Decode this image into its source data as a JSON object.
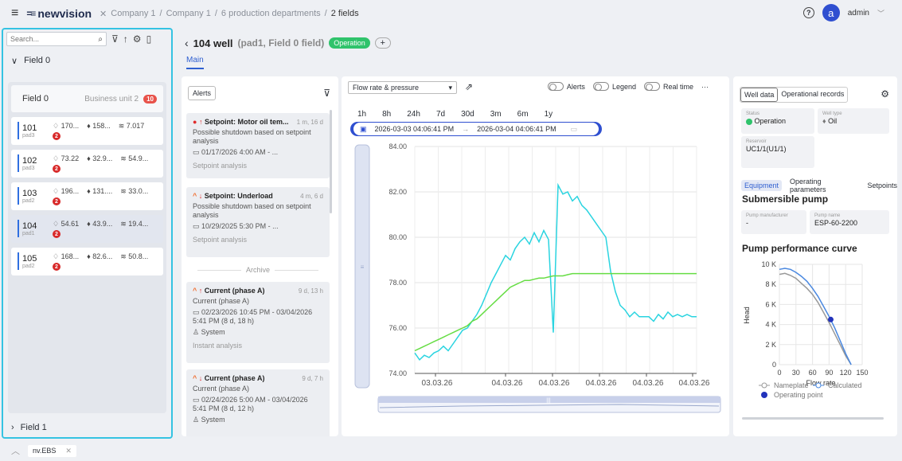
{
  "topbar": {
    "brand": "newvision",
    "breadcrumbs": [
      "Company 1",
      "Company 1",
      "6 production departments"
    ],
    "current": "2 fields",
    "user": "admin",
    "avatar_letter": "a"
  },
  "left": {
    "search_placeholder": "Search...",
    "field0": "Field 0",
    "field_card": {
      "name": "Field 0",
      "unit": "Business unit 2",
      "count": "10"
    },
    "wells": [
      {
        "id": "101",
        "pad": "pad3",
        "v1": "170...",
        "v2": "158...",
        "v3": "7.017",
        "alarms": "2"
      },
      {
        "id": "102",
        "pad": "pad3",
        "v1": "73.22",
        "v2": "32.9...",
        "v3": "54.9...",
        "alarms": "2"
      },
      {
        "id": "103",
        "pad": "pad2",
        "v1": "196...",
        "v2": "131....",
        "v3": "33.0...",
        "alarms": "2"
      },
      {
        "id": "104",
        "pad": "pad1",
        "v1": "54.61",
        "v2": "43.9...",
        "v3": "19.4...",
        "alarms": "2"
      },
      {
        "id": "105",
        "pad": "pad2",
        "v1": "168...",
        "v2": "82.6...",
        "v3": "50.8...",
        "alarms": "2"
      }
    ],
    "field1": "Field 1"
  },
  "bottom": {
    "tab": "nv.EBS"
  },
  "well_header": {
    "title": "104 well",
    "sub": "(pad1, Field 0 field)",
    "status": "Operation",
    "tab": "Main"
  },
  "alerts": {
    "button": "Alerts",
    "archive": "Archive",
    "items": [
      {
        "title": "Setpoint: Motor oil tem...",
        "time": "1 m, 16 d",
        "desc": "Possible shutdown based on setpoint analysis",
        "date": "01/17/2026 4:00 AM - ...",
        "group": "Setpoint analysis"
      },
      {
        "title": "Setpoint: Underload",
        "time": "4 m, 6 d",
        "desc": "Possible shutdown based on setpoint analysis",
        "date": "10/29/2025 5:30 PM - ...",
        "group": "Setpoint analysis"
      },
      {
        "title": "Current (phase A)",
        "time": "9 d, 13 h",
        "desc": "Current (phase A)",
        "date": "02/23/2026 10:45 PM - 03/04/2026 5:41 PM (8 d, 18 h)",
        "user": "System",
        "group": "Instant analysis"
      },
      {
        "title": "Current (phase A)",
        "time": "9 d, 7 h",
        "desc": "Current (phase A)",
        "date": "02/24/2026 5:00 AM - 03/04/2026 5:41 PM (8 d, 12 h)",
        "user": "System"
      }
    ]
  },
  "chart_panel": {
    "select": "Flow rate & pressure",
    "toggles": [
      "Alerts",
      "Legend",
      "Real time"
    ],
    "ranges": [
      "1h",
      "8h",
      "24h",
      "7d",
      "30d",
      "3m",
      "6m",
      "1y"
    ],
    "from": "2026-03-03 04:06:41 PM",
    "to": "2026-03-04 04:06:41 PM"
  },
  "chart_data": {
    "type": "line",
    "ylim": [
      74,
      84
    ],
    "yticks": [
      "84.00",
      "82.00",
      "80.00",
      "78.00",
      "76.00",
      "74.00"
    ],
    "xticks": [
      "03.03.26",
      "04.03.26",
      "04.03.26",
      "04.03.26",
      "04.03.26",
      "04.03.26"
    ],
    "x": [
      0,
      1,
      2,
      3,
      4,
      5,
      6,
      7,
      8,
      9,
      10,
      11,
      12,
      13,
      14,
      15,
      16,
      17,
      18,
      19,
      20,
      21,
      22,
      23,
      24,
      25,
      26,
      27,
      28,
      29,
      30,
      31,
      32,
      33,
      34,
      35,
      36,
      37,
      38,
      39,
      40,
      41,
      42,
      43,
      44,
      45,
      46,
      47,
      48,
      49,
      50,
      51,
      52,
      53,
      54,
      55,
      56,
      57,
      58,
      59
    ],
    "series": [
      {
        "color": "#2ad4e0",
        "values": [
          74.9,
          74.6,
          74.8,
          74.7,
          74.9,
          75.0,
          75.2,
          75.0,
          75.3,
          75.6,
          75.9,
          76.0,
          76.3,
          76.6,
          77.0,
          77.5,
          78.0,
          78.4,
          78.8,
          79.2,
          79.0,
          79.5,
          79.8,
          80.0,
          79.7,
          80.2,
          79.8,
          80.3,
          79.9,
          75.8,
          82.3,
          81.9,
          82.0,
          81.6,
          81.8,
          81.4,
          81.2,
          80.9,
          80.6,
          80.3,
          80.0,
          78.5,
          77.6,
          77.0,
          76.8,
          76.5,
          76.7,
          76.5,
          76.5,
          76.5,
          76.3,
          76.6,
          76.4,
          76.7,
          76.5,
          76.6,
          76.5,
          76.6,
          76.5,
          76.5
        ]
      },
      {
        "color": "#66dd44",
        "values": [
          75.0,
          75.1,
          75.2,
          75.3,
          75.4,
          75.5,
          75.6,
          75.7,
          75.8,
          75.9,
          76.0,
          76.1,
          76.3,
          76.4,
          76.6,
          76.8,
          77.0,
          77.2,
          77.4,
          77.6,
          77.8,
          77.9,
          78.0,
          78.1,
          78.1,
          78.15,
          78.2,
          78.2,
          78.25,
          78.3,
          78.3,
          78.3,
          78.35,
          78.4,
          78.4,
          78.4,
          78.4,
          78.4,
          78.4,
          78.4,
          78.4,
          78.4,
          78.4,
          78.4,
          78.4,
          78.4,
          78.4,
          78.4,
          78.4,
          78.4,
          78.4,
          78.4,
          78.4,
          78.4,
          78.4,
          78.4,
          78.4,
          78.4,
          78.4,
          78.4
        ]
      }
    ]
  },
  "right": {
    "tabs": [
      "Well data",
      "Operational records"
    ],
    "status_label": "Status",
    "status": "Operation",
    "welltype_label": "Well type",
    "welltype": "Oil",
    "reservoir_label": "Reservoir",
    "reservoir": "UC1/1(U1/1)",
    "eq_tabs": [
      "Equipment",
      "Operating parameters",
      "Setpoints"
    ],
    "pump_title": "Submersible pump",
    "manuf_label": "Pump manufacturer",
    "manuf": "-",
    "pumpname_label": "Pump name",
    "pumpname": "ESP-60-2200",
    "curve_title": "Pump performance curve",
    "curve": {
      "yticks": [
        "10 K",
        "8 K",
        "6 K",
        "4 K",
        "2 K",
        "0"
      ],
      "xticks": [
        "0",
        "30",
        "60",
        "90",
        "120",
        "150"
      ],
      "ylabel": "Head",
      "xlabel": "Flow rate",
      "legend": [
        "Nameplate",
        "Calculated",
        "Operating point"
      ],
      "nameplate_color": "#999999",
      "calc_color": "#4a88e0",
      "op_color": "#2233bb",
      "x": [
        0,
        10,
        20,
        30,
        40,
        50,
        60,
        70,
        80,
        90,
        100,
        110,
        120,
        130
      ],
      "nameplate": [
        9.0,
        9.1,
        8.9,
        8.6,
        8.1,
        7.6,
        7.0,
        6.2,
        5.2,
        4.2,
        3.1,
        2.0,
        0.9,
        0
      ],
      "calculated": [
        9.5,
        9.6,
        9.5,
        9.2,
        8.8,
        8.3,
        7.6,
        6.8,
        5.8,
        4.8,
        3.7,
        2.4,
        1.1,
        0
      ],
      "operating_point": [
        93,
        4.5
      ]
    }
  }
}
